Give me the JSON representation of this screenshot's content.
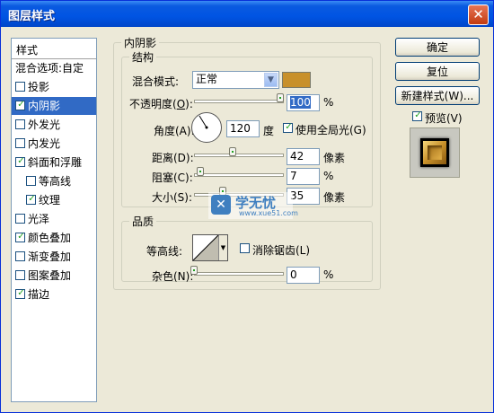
{
  "window": {
    "title": "图层样式",
    "close_label": "✕"
  },
  "styles_panel": {
    "header": "样式",
    "items": [
      {
        "label": "混合选项:自定",
        "checkbox": false,
        "checked": false,
        "indent": false,
        "selected": false
      },
      {
        "label": "投影",
        "checkbox": true,
        "checked": false,
        "indent": false,
        "selected": false
      },
      {
        "label": "内阴影",
        "checkbox": true,
        "checked": true,
        "indent": false,
        "selected": true
      },
      {
        "label": "外发光",
        "checkbox": true,
        "checked": false,
        "indent": false,
        "selected": false
      },
      {
        "label": "内发光",
        "checkbox": true,
        "checked": false,
        "indent": false,
        "selected": false
      },
      {
        "label": "斜面和浮雕",
        "checkbox": true,
        "checked": true,
        "indent": false,
        "selected": false
      },
      {
        "label": "等高线",
        "checkbox": true,
        "checked": false,
        "indent": true,
        "selected": false
      },
      {
        "label": "纹理",
        "checkbox": true,
        "checked": true,
        "indent": true,
        "selected": false
      },
      {
        "label": "光泽",
        "checkbox": true,
        "checked": false,
        "indent": false,
        "selected": false
      },
      {
        "label": "颜色叠加",
        "checkbox": true,
        "checked": true,
        "indent": false,
        "selected": false
      },
      {
        "label": "渐变叠加",
        "checkbox": true,
        "checked": false,
        "indent": false,
        "selected": false
      },
      {
        "label": "图案叠加",
        "checkbox": true,
        "checked": false,
        "indent": false,
        "selected": false
      },
      {
        "label": "描边",
        "checkbox": true,
        "checked": true,
        "indent": false,
        "selected": false
      }
    ]
  },
  "inner_shadow": {
    "section_title": "内阴影",
    "structure": {
      "title": "结构",
      "blend_mode_label": "混合模式:",
      "blend_mode_value": "正常",
      "shadow_color": "#c8902a",
      "opacity_label_main": "不透明度(",
      "opacity_label_key": "O",
      "opacity_label_end": "):",
      "opacity_value": "100",
      "opacity_level": 1.0,
      "opacity_unit": "%",
      "angle_label": "角度(A):",
      "angle_value": "120",
      "angle_unit": "度",
      "global_light_label": "使用全局光(G)",
      "global_light_checked": true,
      "distance_label": "距离(D):",
      "distance_value": "42",
      "distance_unit": "像素",
      "choke_label": "阻塞(C):",
      "choke_value": "7",
      "choke_unit": "%",
      "size_label": "大小(S):",
      "size_value": "35",
      "size_unit": "像素"
    },
    "quality": {
      "title": "品质",
      "contour_label": "等高线:",
      "antialias_label": "消除锯齿(L)",
      "antialias_checked": false,
      "noise_label": "杂色(N):",
      "noise_value": "0",
      "noise_unit": "%"
    }
  },
  "buttons": {
    "ok": "确定",
    "reset": "复位",
    "new_style": "新建样式(W)...",
    "preview_label": "预览(V)",
    "preview_checked": true
  },
  "watermark": {
    "brand": "学无忧",
    "url": "www.xue51.com"
  },
  "colors": {
    "selection": "#316ac5",
    "dialog_bg": "#ece9d8",
    "title_bar": "#0054e3",
    "check_green": "#21a121"
  }
}
